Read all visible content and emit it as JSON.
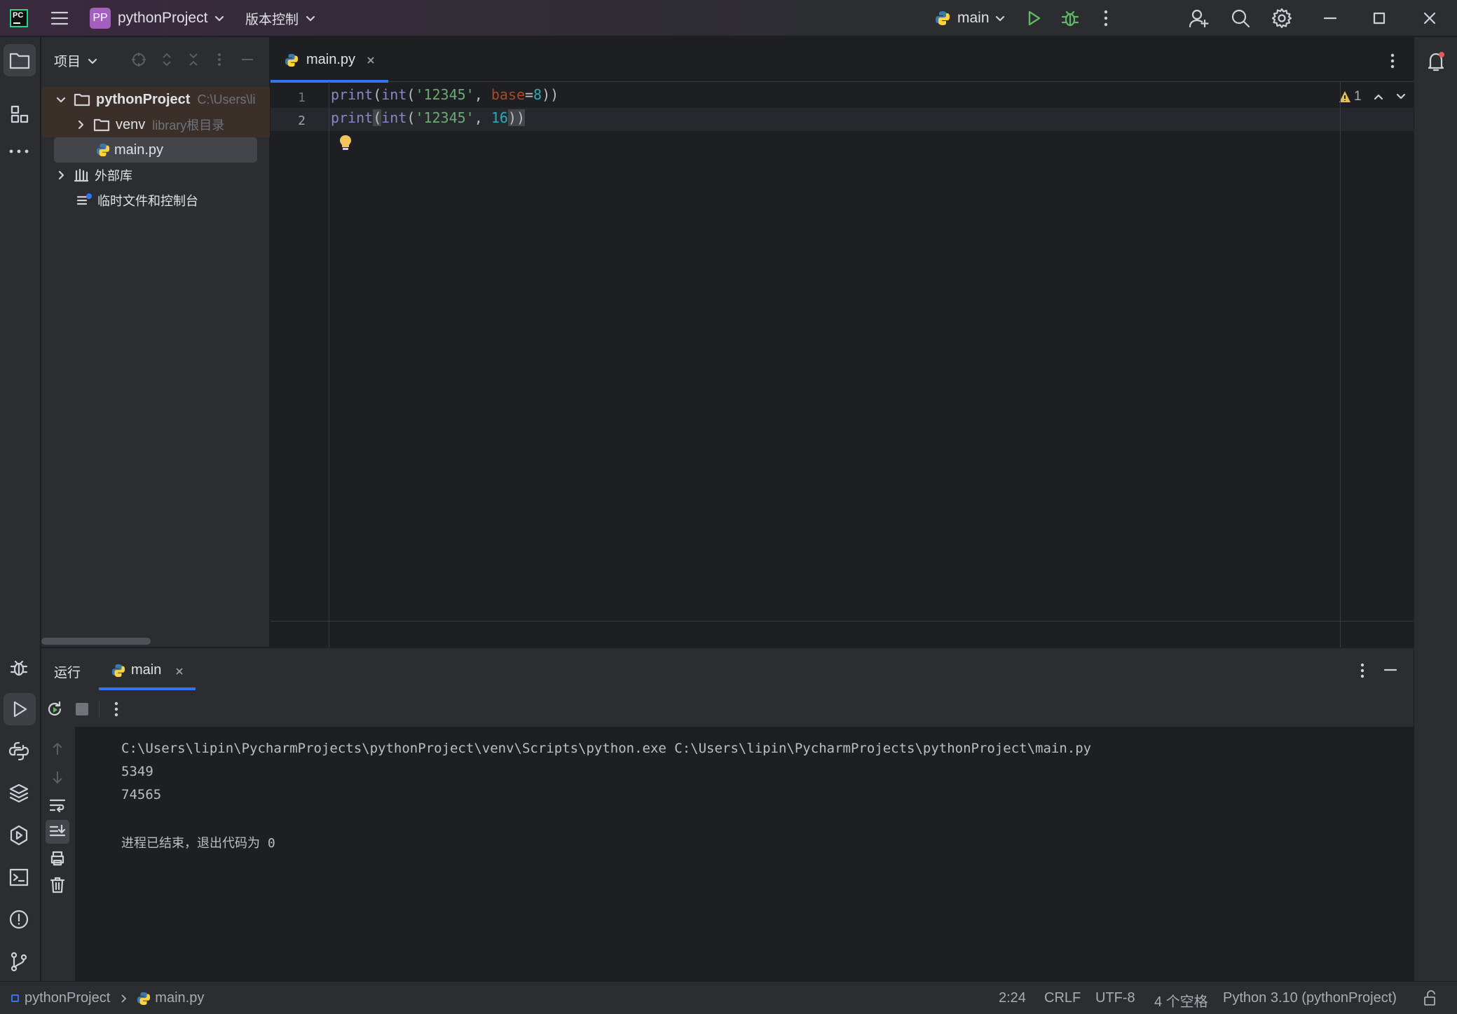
{
  "titlebar": {
    "app_logo": "PC",
    "project_badge": "PP",
    "project_name": "pythonProject",
    "vcs_label": "版本控制",
    "run_config": "main"
  },
  "project_panel": {
    "title": "项目",
    "tree": [
      {
        "label": "pythonProject",
        "hint": "C:\\Users\\li"
      },
      {
        "label": "venv",
        "hint": "library根目录"
      },
      {
        "label": "main.py"
      },
      {
        "label": "外部库"
      },
      {
        "label": "临时文件和控制台"
      }
    ]
  },
  "editor": {
    "tab_label": "main.py",
    "warnings_count": "1",
    "line_numbers": [
      "1",
      "2"
    ],
    "lines": [
      {
        "fn": "print",
        "p1": "(",
        "fn2": "int",
        "p2": "(",
        "str": "'12345'",
        "comma": ", ",
        "param": "base",
        "eq": "=",
        "num": "8",
        "close": "))"
      },
      {
        "fn": "print",
        "p1": "(",
        "fn2": "int",
        "p2": "(",
        "str": "'12345'",
        "comma": ", ",
        "num": "16",
        "close": "))"
      }
    ]
  },
  "run_panel": {
    "title": "运行",
    "tab_label": "main",
    "console": [
      "C:\\Users\\lipin\\PycharmProjects\\pythonProject\\venv\\Scripts\\python.exe C:\\Users\\lipin\\PycharmProjects\\pythonProject\\main.py",
      "5349",
      "74565",
      "",
      "进程已结束，退出代码为 0"
    ]
  },
  "statusbar": {
    "breadcrumb_project": "pythonProject",
    "breadcrumb_file": "main.py",
    "position": "2:24",
    "line_sep": "CRLF",
    "encoding": "UTF-8",
    "indent": "4 个空格",
    "interpreter": "Python 3.10 (pythonProject)"
  },
  "colors": {
    "accent": "#3574f0",
    "run_green": "#5fb865",
    "python_yellow": "#ffd43b",
    "python_blue": "#3c78aa",
    "warning": "#e2c04f"
  }
}
